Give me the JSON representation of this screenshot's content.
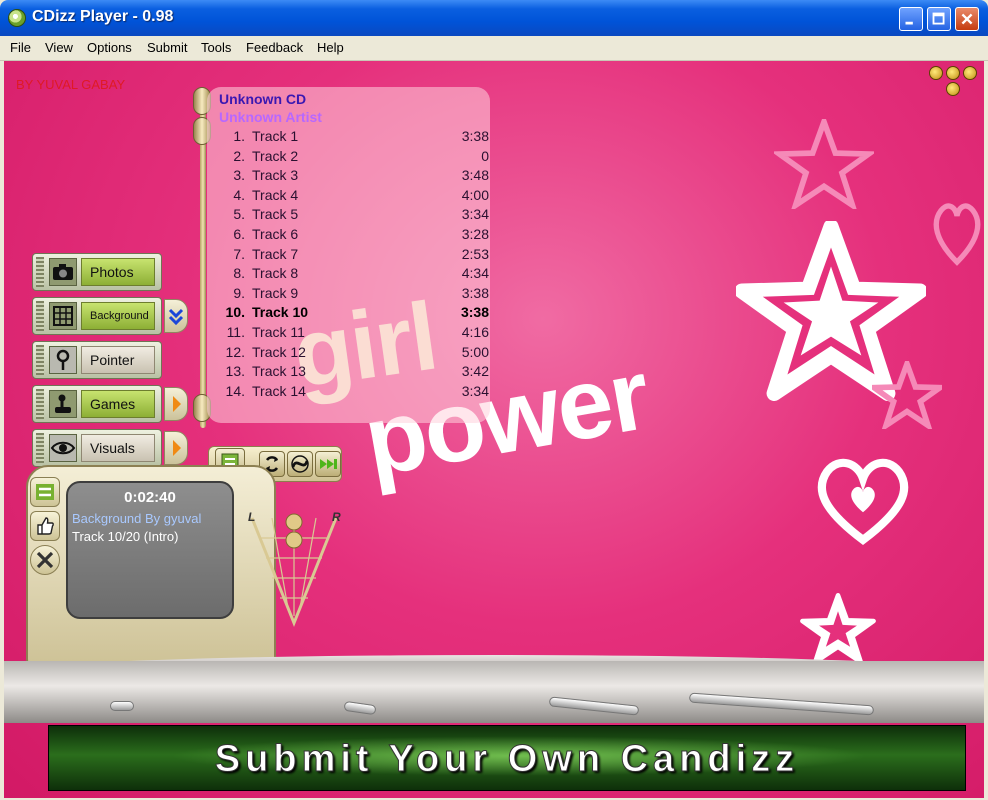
{
  "window": {
    "title": "CDizz Player - 0.98",
    "minimize_label": "Minimize",
    "maximize_label": "Maximize",
    "close_label": "Close"
  },
  "menu": [
    "File",
    "View",
    "Options",
    "Submit",
    "Tools",
    "Feedback",
    "Help"
  ],
  "skin": {
    "byline": "BY YUVAL GABAY",
    "logo_line1": "girl",
    "logo_line2": "power"
  },
  "playlist": {
    "album": "Unknown CD",
    "artist": "Unknown Artist",
    "current_index": 9,
    "tracks": [
      {
        "num": "1.",
        "name": "Track 1",
        "dur": "3:38"
      },
      {
        "num": "2.",
        "name": "Track 2",
        "dur": "0"
      },
      {
        "num": "3.",
        "name": "Track 3",
        "dur": "3:48"
      },
      {
        "num": "4.",
        "name": "Track 4",
        "dur": "4:00"
      },
      {
        "num": "5.",
        "name": "Track 5",
        "dur": "3:34"
      },
      {
        "num": "6.",
        "name": "Track 6",
        "dur": "3:28"
      },
      {
        "num": "7.",
        "name": "Track 7",
        "dur": "2:53"
      },
      {
        "num": "8.",
        "name": "Track 8",
        "dur": "4:34"
      },
      {
        "num": "9.",
        "name": "Track 9",
        "dur": "3:38"
      },
      {
        "num": "10.",
        "name": "Track 10",
        "dur": "3:38"
      },
      {
        "num": "11.",
        "name": "Track 11",
        "dur": "4:16"
      },
      {
        "num": "12.",
        "name": "Track 12",
        "dur": "5:00"
      },
      {
        "num": "13.",
        "name": "Track 13",
        "dur": "3:42"
      },
      {
        "num": "14.",
        "name": "Track 14",
        "dur": "3:34"
      }
    ]
  },
  "side_menu": {
    "photos": "Photos",
    "background": "Background",
    "pointer": "Pointer",
    "games": "Games",
    "visuals": "Visuals"
  },
  "display": {
    "time": "0:02:40",
    "line1": "Background By gyuval",
    "line2": "Track 10/20 (Intro)"
  },
  "eq": {
    "left": "L",
    "right": "R"
  },
  "banner": {
    "text": "Submit Your Own Candizz"
  },
  "colors": {
    "background_pink": "#e5307c",
    "playlist_album": "#3a18b2",
    "playlist_artist": "#b768ff",
    "byline": "#e01818",
    "play_green": "#6bd02a"
  }
}
